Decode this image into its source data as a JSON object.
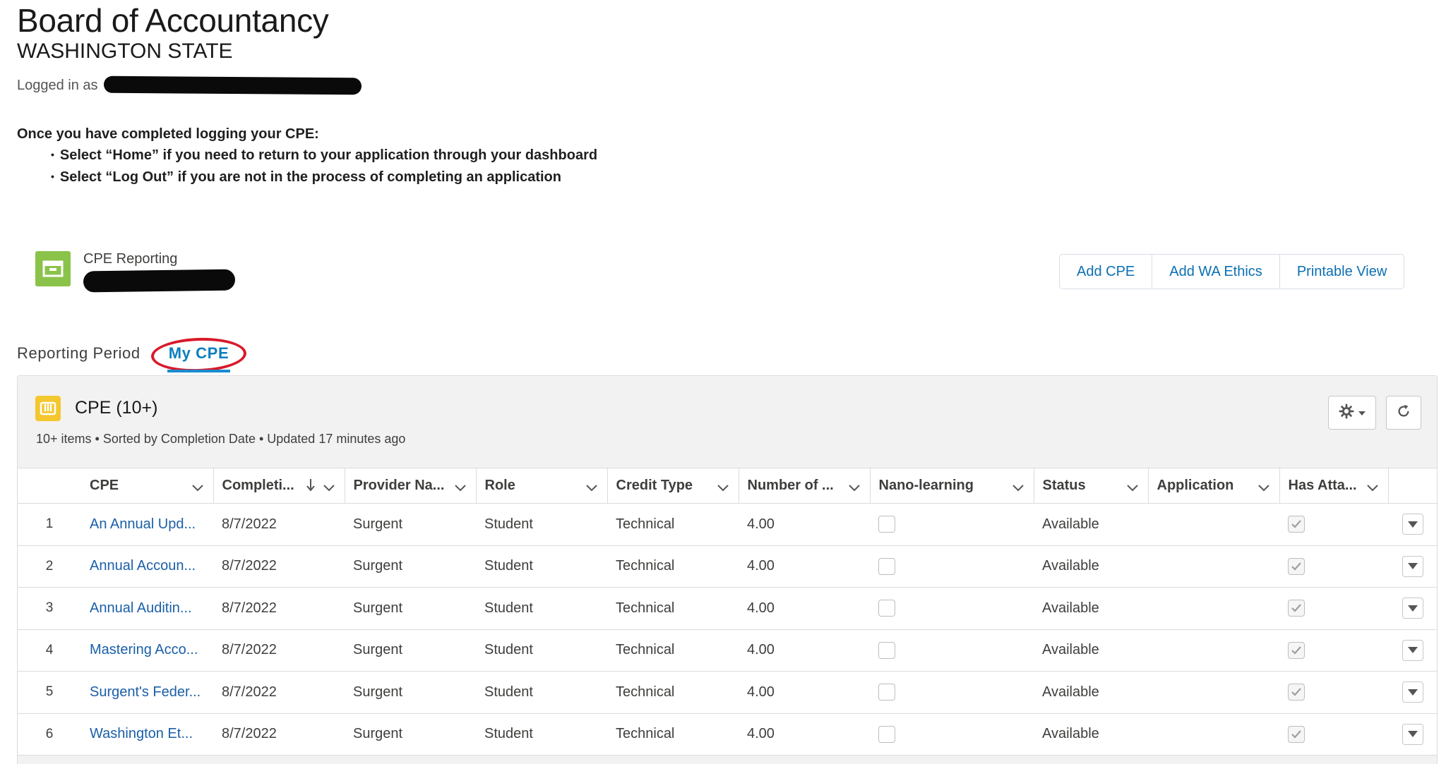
{
  "header": {
    "title": "Board of Accountancy",
    "subtitle": "WASHINGTON STATE",
    "logged_in_label": "Logged in as"
  },
  "instructions": {
    "heading": "Once you have completed logging your CPE:",
    "bullets": [
      "Select “Home” if you need to return to your application through your dashboard",
      "Select “Log Out” if you are not in the process of completing an application"
    ]
  },
  "record": {
    "type_label": "CPE Reporting",
    "icon": "record-icon",
    "icon_color": "#8bc34a"
  },
  "actions": {
    "add_cpe": "Add CPE",
    "add_wa_ethics": "Add WA Ethics",
    "printable_view": "Printable View"
  },
  "tabs": {
    "reporting_period": "Reporting Period",
    "my_cpe": "My CPE",
    "active": "my_cpe",
    "active_color": "#0b7fbf",
    "annotation_color": "#d8192a"
  },
  "list": {
    "title": "CPE (10+)",
    "meta": "10+ items • Sorted by Completion Date • Updated 17 minutes ago",
    "icon": "list-icon",
    "icon_color": "#f4c72f",
    "columns": [
      "CPE",
      "Completi...",
      "Provider Na...",
      "Role",
      "Credit Type",
      "Number of ...",
      "Nano-learning",
      "Status",
      "Application",
      "Has Atta..."
    ],
    "sorted_column": "Completi...",
    "rows": [
      {
        "num": "1",
        "cpe": "An Annual Upd...",
        "date": "8/7/2022",
        "provider": "Surgent",
        "role": "Student",
        "credit_type": "Technical",
        "number": "4.00",
        "nano": false,
        "status": "Available",
        "application": "",
        "has_attachment": true
      },
      {
        "num": "2",
        "cpe": "Annual Accoun...",
        "date": "8/7/2022",
        "provider": "Surgent",
        "role": "Student",
        "credit_type": "Technical",
        "number": "4.00",
        "nano": false,
        "status": "Available",
        "application": "",
        "has_attachment": true
      },
      {
        "num": "3",
        "cpe": "Annual Auditin...",
        "date": "8/7/2022",
        "provider": "Surgent",
        "role": "Student",
        "credit_type": "Technical",
        "number": "4.00",
        "nano": false,
        "status": "Available",
        "application": "",
        "has_attachment": true
      },
      {
        "num": "4",
        "cpe": "Mastering Acco...",
        "date": "8/7/2022",
        "provider": "Surgent",
        "role": "Student",
        "credit_type": "Technical",
        "number": "4.00",
        "nano": false,
        "status": "Available",
        "application": "",
        "has_attachment": true
      },
      {
        "num": "5",
        "cpe": "Surgent's Feder...",
        "date": "8/7/2022",
        "provider": "Surgent",
        "role": "Student",
        "credit_type": "Technical",
        "number": "4.00",
        "nano": false,
        "status": "Available",
        "application": "",
        "has_attachment": true
      },
      {
        "num": "6",
        "cpe": "Washington Et...",
        "date": "8/7/2022",
        "provider": "Surgent",
        "role": "Student",
        "credit_type": "Technical",
        "number": "4.00",
        "nano": false,
        "status": "Available",
        "application": "",
        "has_attachment": true
      }
    ]
  },
  "colors": {
    "link": "#1b5fa8",
    "button_text": "#0b6fb3",
    "card_bg": "#f3f2f2",
    "border": "#dddbda"
  }
}
